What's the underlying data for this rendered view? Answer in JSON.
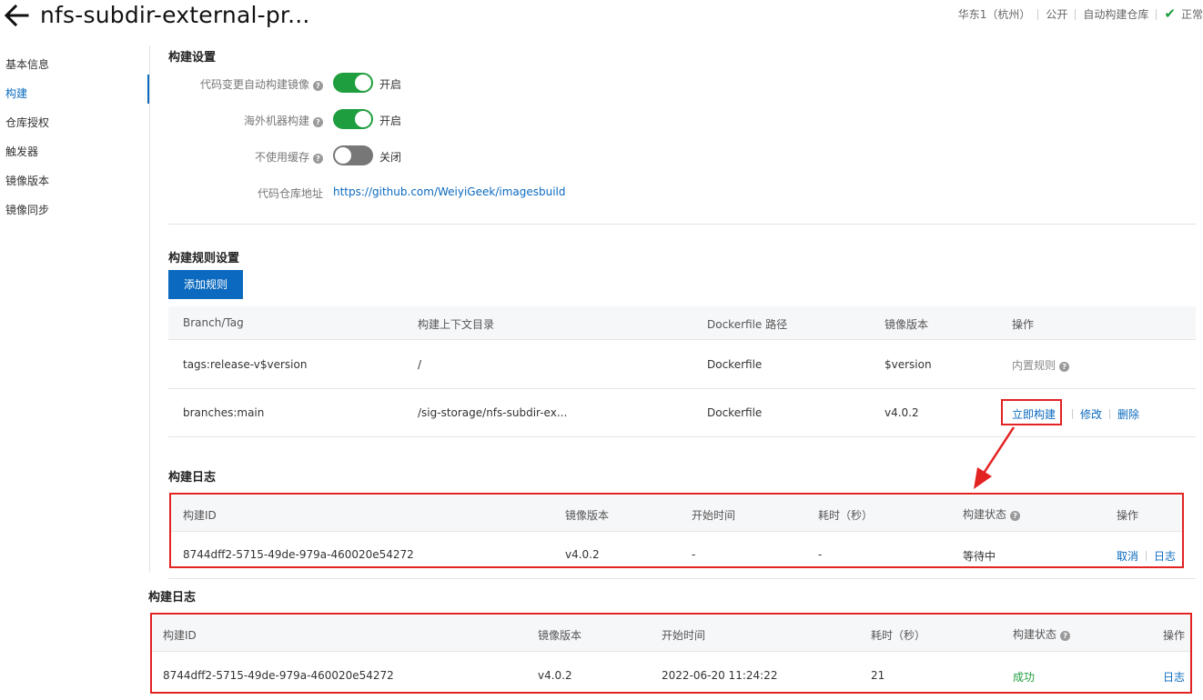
{
  "header": {
    "title": "nfs-subdir-external-pr...",
    "region": "华东1（杭州）",
    "visibility": "公开",
    "repo_type": "自动构建仓库",
    "status": "正常"
  },
  "sidebar": {
    "items": [
      {
        "label": "基本信息"
      },
      {
        "label": "构建",
        "active": true
      },
      {
        "label": "仓库授权"
      },
      {
        "label": "触发器"
      },
      {
        "label": "镜像版本"
      },
      {
        "label": "镜像同步"
      }
    ]
  },
  "build_settings": {
    "title": "构建设置",
    "auto_build": {
      "label": "代码变更自动构建镜像",
      "state": "开启",
      "on": true
    },
    "overseas": {
      "label": "海外机器构建",
      "state": "开启",
      "on": true
    },
    "no_cache": {
      "label": "不使用缓存",
      "state": "关闭",
      "on": false
    },
    "repo": {
      "label": "代码仓库地址",
      "url": "https://github.com/WeiyiGeek/imagesbuild"
    }
  },
  "rules": {
    "title": "构建规则设置",
    "add_label": "添加规则",
    "columns": [
      "Branch/Tag",
      "构建上下文目录",
      "Dockerfile 路径",
      "镜像版本",
      "操作"
    ],
    "rows": [
      {
        "branch": "tags:release-v$version",
        "context": "/",
        "dockerfile": "Dockerfile",
        "version": "$version",
        "builtin": "内置规则"
      },
      {
        "branch": "branches:main",
        "context": "/sig-storage/nfs-subdir-ex...",
        "dockerfile": "Dockerfile",
        "version": "v4.0.2",
        "build_now": "立即构建",
        "edit": "修改",
        "delete": "删除"
      }
    ]
  },
  "log1": {
    "title": "构建日志",
    "columns": [
      "构建ID",
      "镜像版本",
      "开始时间",
      "耗时（秒）",
      "构建状态",
      "操作"
    ],
    "row": {
      "id": "8744dff2-5715-49de-979a-460020e54272",
      "version": "v4.0.2",
      "start": "-",
      "duration": "-",
      "status": "等待中",
      "cancel": "取消",
      "log": "日志"
    }
  },
  "log2": {
    "title": "构建日志",
    "columns": [
      "构建ID",
      "镜像版本",
      "开始时间",
      "耗时（秒）",
      "构建状态",
      "操作"
    ],
    "row": {
      "id": "8744dff2-5715-49de-979a-460020e54272",
      "version": "v4.0.2",
      "start": "2022-06-20 11:24:22",
      "duration": "21",
      "status": "成功",
      "log": "日志"
    }
  },
  "colors": {
    "accent": "#0b6abf",
    "success": "#1e9e3e",
    "annotation": "#e32222"
  }
}
